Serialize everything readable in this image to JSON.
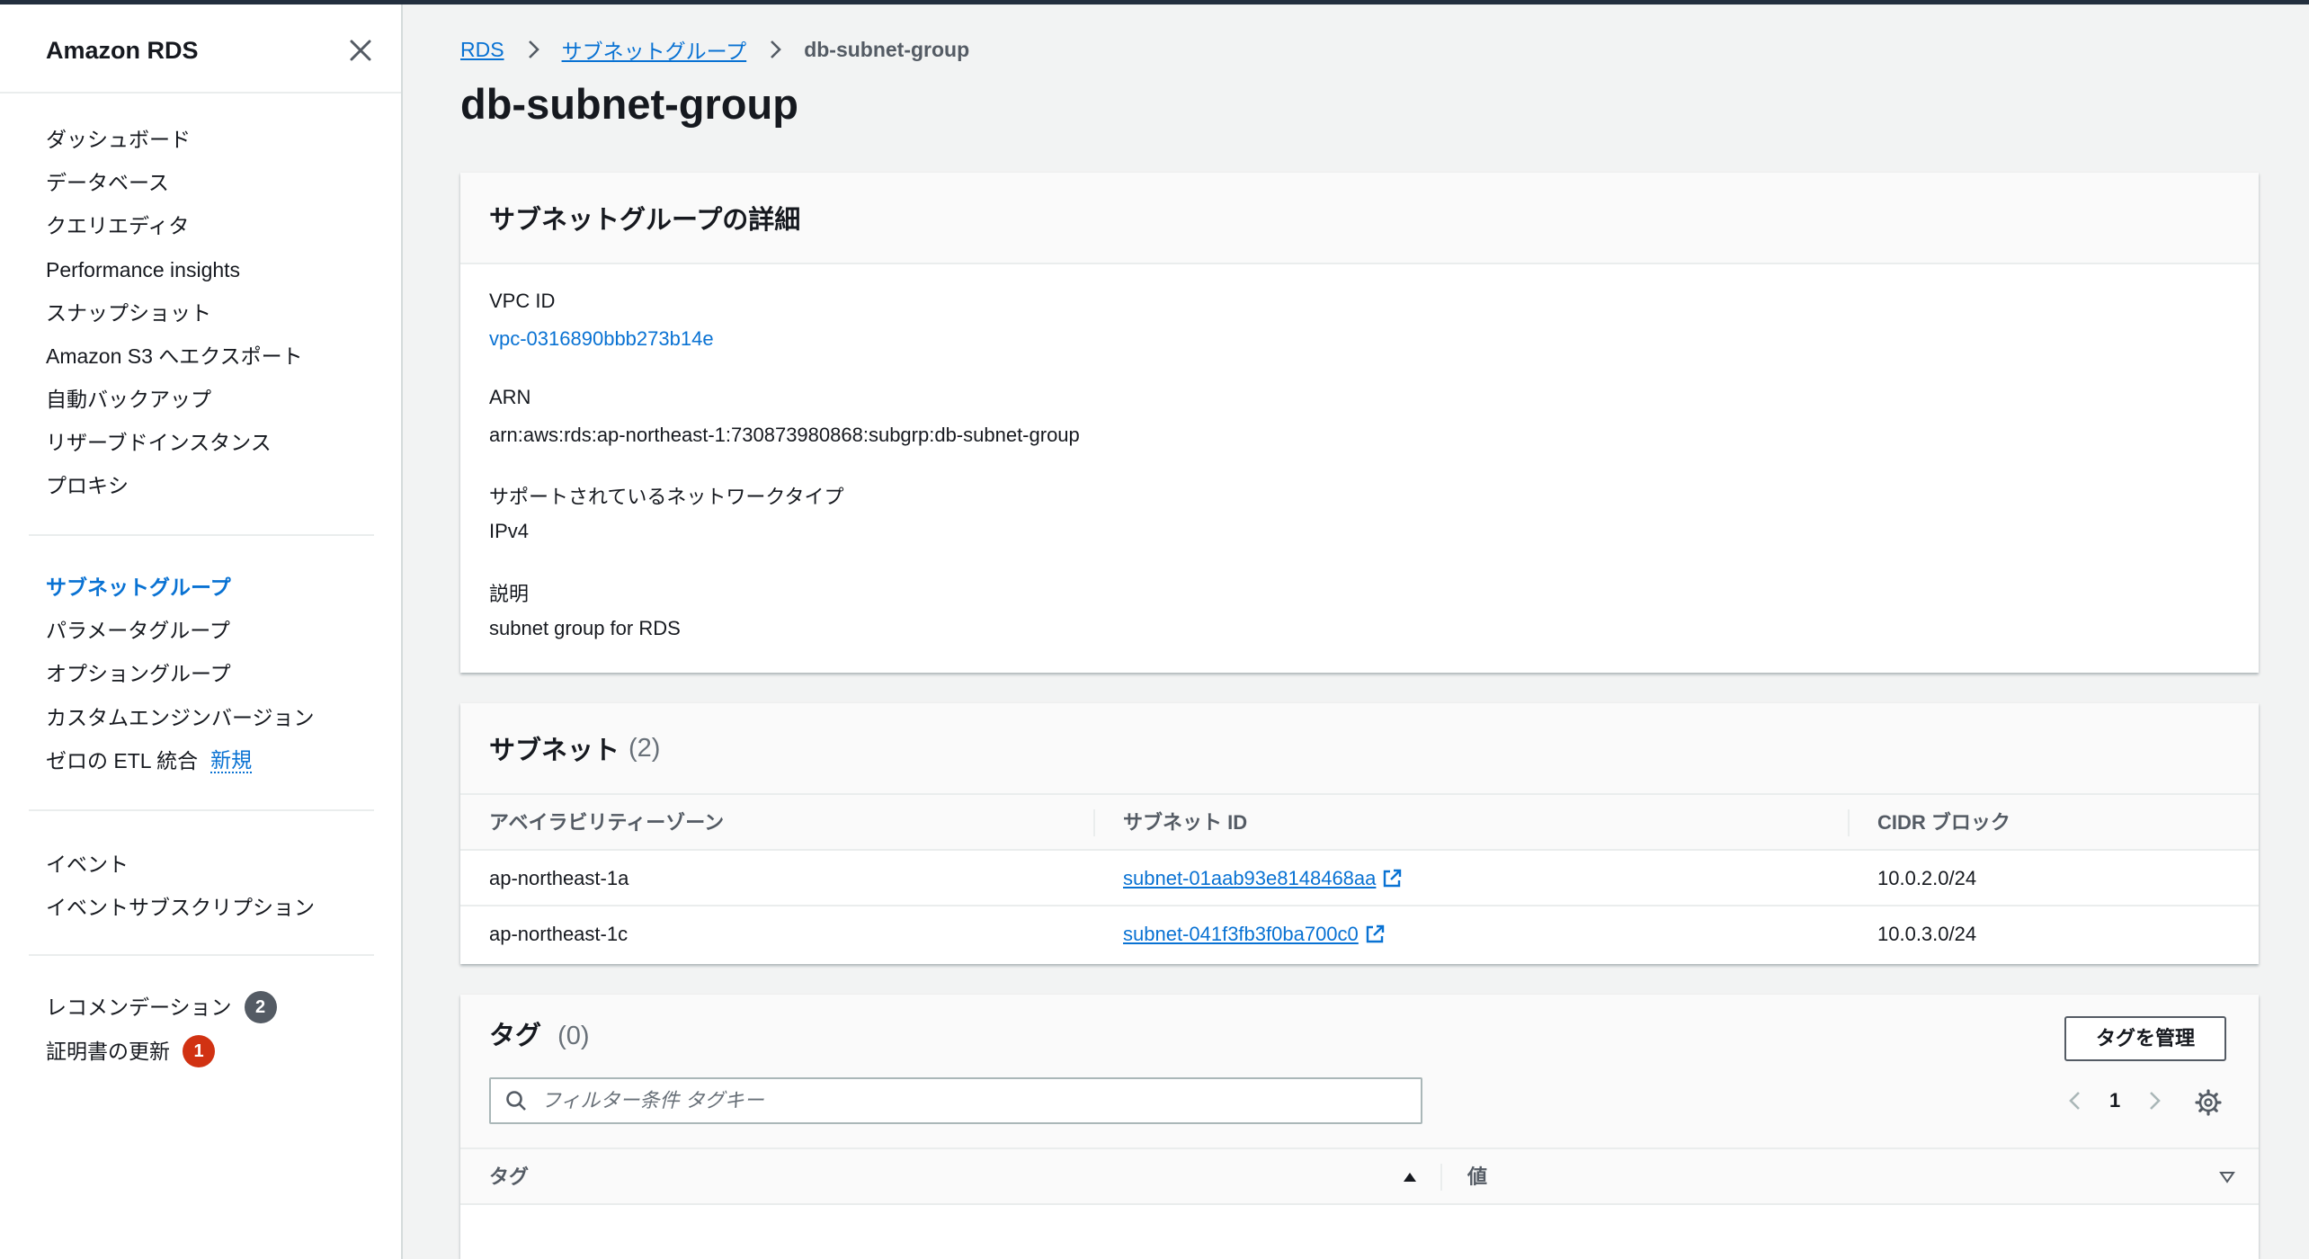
{
  "sidebar": {
    "title": "Amazon RDS",
    "group1": [
      {
        "label": "ダッシュボード"
      },
      {
        "label": "データベース"
      },
      {
        "label": "クエリエディタ"
      },
      {
        "label": "Performance insights"
      },
      {
        "label": "スナップショット"
      },
      {
        "label": "Amazon S3 へエクスポート"
      },
      {
        "label": "自動バックアップ"
      },
      {
        "label": "リザーブドインスタンス"
      },
      {
        "label": "プロキシ"
      }
    ],
    "group2": [
      {
        "label": "サブネットグループ",
        "active": true
      },
      {
        "label": "パラメータグループ"
      },
      {
        "label": "オプショングループ"
      },
      {
        "label": "カスタムエンジンバージョン"
      },
      {
        "label": "ゼロの ETL 統合",
        "badge": "新規"
      }
    ],
    "group3": [
      {
        "label": "イベント"
      },
      {
        "label": "イベントサブスクリプション"
      }
    ],
    "group4": [
      {
        "label": "レコメンデーション",
        "count": "2",
        "count_color": "#545b64"
      },
      {
        "label": "証明書の更新",
        "count": "1",
        "count_color": "#d13212"
      }
    ]
  },
  "breadcrumb": {
    "items": [
      "RDS",
      "サブネットグループ"
    ],
    "current": "db-subnet-group"
  },
  "page_title": "db-subnet-group",
  "details": {
    "header": "サブネットグループの詳細",
    "vpc_label": "VPC ID",
    "vpc_value": "vpc-0316890bbb273b14e",
    "arn_label": "ARN",
    "arn_value": "arn:aws:rds:ap-northeast-1:730873980868:subgrp:db-subnet-group",
    "network_label": "サポートされているネットワークタイプ",
    "network_value": "IPv4",
    "desc_label": "説明",
    "desc_value": "subnet group for RDS"
  },
  "subnets": {
    "header": "サブネット",
    "count": "(2)",
    "columns": [
      "アベイラビリティーゾーン",
      "サブネット ID",
      "CIDR ブロック"
    ],
    "rows": [
      {
        "az": "ap-northeast-1a",
        "subnet_id": "subnet-01aab93e8148468aa",
        "cidr": "10.0.2.0/24"
      },
      {
        "az": "ap-northeast-1c",
        "subnet_id": "subnet-041f3fb3f0ba700c0",
        "cidr": "10.0.3.0/24"
      }
    ]
  },
  "tags": {
    "header": "タグ",
    "count": "(0)",
    "manage_button": "タグを管理",
    "filter_placeholder": "フィルター条件 タグキー",
    "page": "1",
    "columns": [
      "タグ",
      "値"
    ]
  },
  "colors": {
    "accent": "#0972d3",
    "header_bar": "#232f3e",
    "badge_gray": "#545b64",
    "badge_red": "#d13212"
  }
}
